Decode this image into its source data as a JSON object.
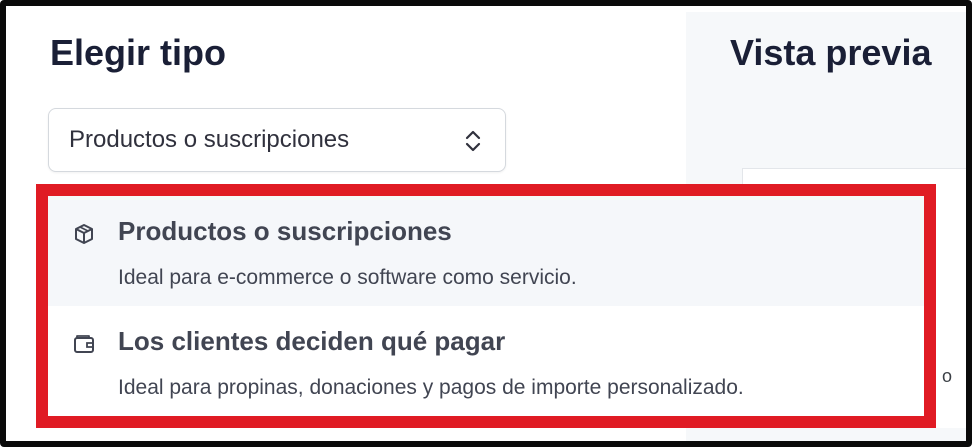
{
  "left": {
    "title": "Elegir tipo",
    "select": {
      "value": "Productos o suscripciones",
      "icon": "chevron-up-down-icon"
    },
    "options": [
      {
        "icon": "box-icon",
        "title": "Productos o suscripciones",
        "description": "Ideal para e-commerce o software como servicio."
      },
      {
        "icon": "wallet-icon",
        "title": "Los clientes deciden qué pagar",
        "description": "Ideal para propinas, donaciones y pagos de importe personalizado."
      }
    ]
  },
  "right": {
    "title": "Vista previa",
    "fragment": "o"
  },
  "colors": {
    "highlight": "#e01b24",
    "text_dark": "#1a1f36",
    "text_body": "#414552",
    "hover_bg": "#f5f7fa",
    "preview_bg": "#f6f8fa"
  }
}
